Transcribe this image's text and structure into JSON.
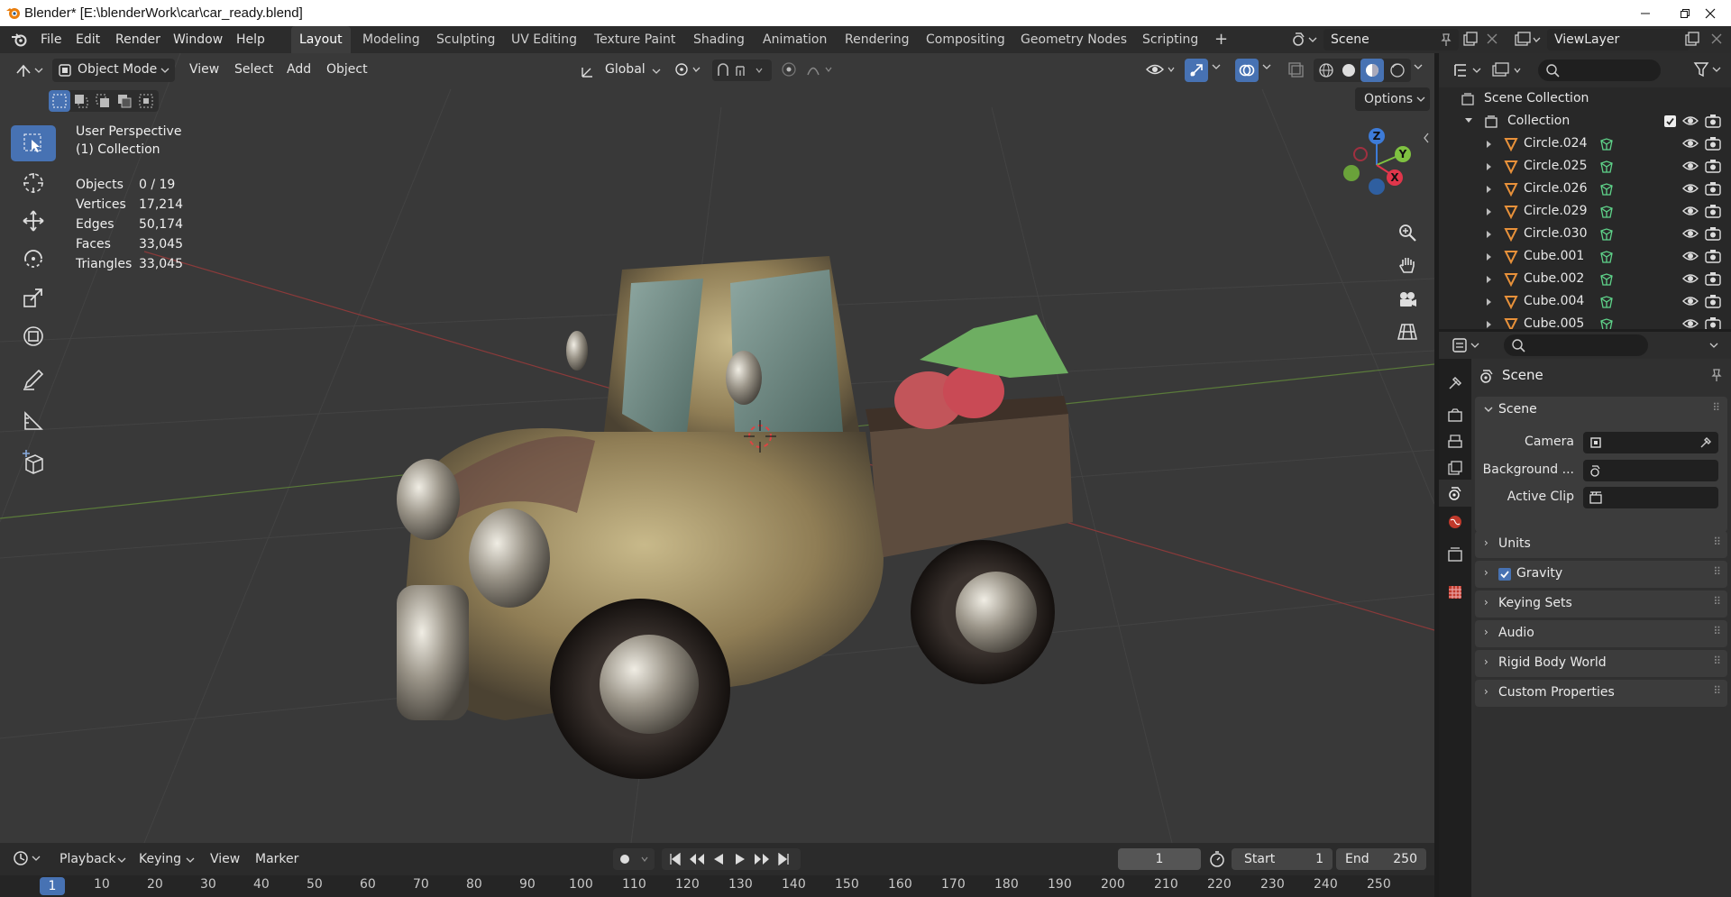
{
  "titlebar": {
    "title": "Blender* [E:\\blenderWork\\car\\car_ready.blend]"
  },
  "menubar": {
    "menus": [
      "File",
      "Edit",
      "Render",
      "Window",
      "Help"
    ],
    "workspaces": [
      "Layout",
      "Modeling",
      "Sculpting",
      "UV Editing",
      "Texture Paint",
      "Shading",
      "Animation",
      "Rendering",
      "Compositing",
      "Geometry Nodes",
      "Scripting"
    ],
    "add_workspace": "+",
    "scene": "Scene",
    "view_layer": "ViewLayer"
  },
  "viewport": {
    "mode": "Object Mode",
    "menus": [
      "View",
      "Select",
      "Add",
      "Object"
    ],
    "orientation": "Global",
    "options_label": "Options",
    "info": {
      "line1": "User Perspective",
      "line2": "(1) Collection"
    },
    "stats": [
      {
        "label": "Objects",
        "value": "0 / 19"
      },
      {
        "label": "Vertices",
        "value": "17,214"
      },
      {
        "label": "Edges",
        "value": "50,174"
      },
      {
        "label": "Faces",
        "value": "33,045"
      },
      {
        "label": "Triangles",
        "value": "33,045"
      }
    ],
    "gizmo": {
      "z": "Z",
      "y": "Y",
      "x": "X"
    }
  },
  "timeline": {
    "menus": [
      "Playback",
      "Keying",
      "View",
      "Marker"
    ],
    "current_frame": "1",
    "start_label": "Start",
    "start": "1",
    "end_label": "End",
    "end": "250",
    "ruler": [
      "1",
      "10",
      "20",
      "30",
      "40",
      "50",
      "60",
      "70",
      "80",
      "90",
      "100",
      "110",
      "120",
      "130",
      "140",
      "150",
      "160",
      "170",
      "180",
      "190",
      "200",
      "210",
      "220",
      "230",
      "240",
      "250"
    ]
  },
  "outliner": {
    "root": "Scene Collection",
    "collection": "Collection",
    "items": [
      "Circle.024",
      "Circle.025",
      "Circle.026",
      "Circle.029",
      "Circle.030",
      "Cube.001",
      "Cube.002",
      "Cube.004",
      "Cube.005"
    ]
  },
  "properties": {
    "context": "Scene",
    "section": "Scene",
    "fields": {
      "camera": "Camera",
      "background": "Background ...",
      "active_clip": "Active Clip"
    },
    "panels": [
      "Units",
      "Gravity",
      "Keying Sets",
      "Audio",
      "Rigid Body World",
      "Custom Properties"
    ],
    "gravity_checked": true
  },
  "colors": {
    "accent": "#4772b3",
    "object_icon": "#e8913a",
    "mesh_icon": "#5fd38a",
    "gizmo_x": "#e0364b",
    "gizmo_y": "#7fc241",
    "gizmo_z": "#3d7bd8"
  }
}
